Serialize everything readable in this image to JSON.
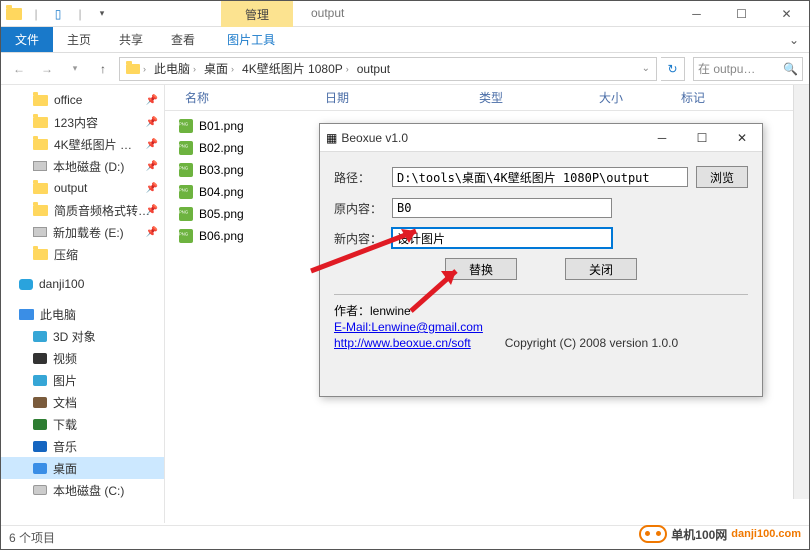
{
  "window": {
    "title": "output",
    "ribbon_context": "管理"
  },
  "ribbon": {
    "file": "文件",
    "home": "主页",
    "share": "共享",
    "view": "查看",
    "pictools": "图片工具"
  },
  "breadcrumb": [
    "此电脑",
    "桌面",
    "4K壁纸图片 1080P",
    "output"
  ],
  "search": {
    "placeholder": "在 outpu…"
  },
  "columns": {
    "name": "名称",
    "date": "日期",
    "type": "类型",
    "size": "大小",
    "tags": "标记"
  },
  "files": [
    "B01.png",
    "B02.png",
    "B03.png",
    "B04.png",
    "B05.png",
    "B06.png"
  ],
  "nav": {
    "quick": [
      {
        "label": "office",
        "pin": true
      },
      {
        "label": "123内容",
        "pin": true
      },
      {
        "label": "4K壁纸图片 …",
        "pin": true
      },
      {
        "label": "本地磁盘 (D:)",
        "pin": true,
        "drive": true
      },
      {
        "label": "output",
        "pin": true
      },
      {
        "label": "简质音频格式转…",
        "pin": true
      },
      {
        "label": "新加载卷 (E:)",
        "pin": true,
        "drive": true
      },
      {
        "label": "压缩"
      }
    ],
    "danji": "danji100",
    "pc": "此电脑",
    "pcitems": [
      {
        "label": "3D 对象",
        "color": "#36a6d6"
      },
      {
        "label": "视频",
        "color": "#333"
      },
      {
        "label": "图片",
        "color": "#36a6d6"
      },
      {
        "label": "文档",
        "color": "#7a5b3c"
      },
      {
        "label": "下载",
        "color": "#2e7d32"
      },
      {
        "label": "音乐",
        "color": "#1565c0"
      },
      {
        "label": "桌面",
        "color": "#3a8ee6",
        "sel": true
      },
      {
        "label": "本地磁盘 (C:)",
        "drive": true
      }
    ]
  },
  "status": {
    "count": "6 个项目"
  },
  "dialog": {
    "title": "Beoxue v1.0",
    "path_lbl": "路径：",
    "path_val": "D:\\tools\\桌面\\4K壁纸图片 1080P\\output",
    "browse": "浏览",
    "orig_lbl": "原内容：",
    "orig_val": "B0",
    "new_lbl": "新内容：",
    "new_val": "设计图片",
    "replace": "替换",
    "close": "关闭",
    "author_lbl": "作者：",
    "author": "lenwine",
    "email": "E-Mail:Lenwine@gmail.com",
    "site": "http://www.beoxue.cn/soft",
    "copyright": "Copyright (C) 2008 version 1.0.0"
  }
}
